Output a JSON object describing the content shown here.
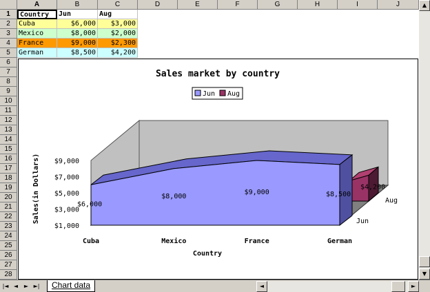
{
  "columns": [
    "A",
    "B",
    "C",
    "D",
    "E",
    "F",
    "G",
    "H",
    "I",
    "J"
  ],
  "rows": [
    "1",
    "2",
    "3",
    "4",
    "5",
    "6",
    "7",
    "8",
    "9",
    "10",
    "11",
    "12",
    "13",
    "14",
    "15",
    "16",
    "17",
    "18",
    "19",
    "20",
    "21",
    "22",
    "23",
    "24",
    "25",
    "26",
    "27",
    "28"
  ],
  "table": {
    "headers": [
      "Country",
      "Jun",
      "Aug"
    ],
    "rows": [
      {
        "country": "Cuba",
        "jun": "$6,000",
        "aug": "$3,000",
        "bg": "#ffff99"
      },
      {
        "country": "Mexico",
        "jun": "$8,000",
        "aug": "$2,000",
        "bg": "#ccffcc"
      },
      {
        "country": "France",
        "jun": "$9,000",
        "aug": "$2,300",
        "bg": "#ff9900"
      },
      {
        "country": "German",
        "jun": "$8,500",
        "aug": "$4,200",
        "bg": "#ccffff"
      }
    ]
  },
  "chart_data": {
    "type": "area",
    "title": "Sales market by country",
    "xlabel": "Country",
    "ylabel": "Sales(in Dollars)",
    "categories": [
      "Cuba",
      "Mexico",
      "France",
      "German"
    ],
    "yticks": [
      "$9,000",
      "$7,000",
      "$5,000",
      "$3,000",
      "$1,000"
    ],
    "ylim": [
      1000,
      9000
    ],
    "legend_position": "top",
    "series": [
      {
        "name": "Jun",
        "values": [
          6000,
          8000,
          9000,
          8500
        ],
        "labels": [
          "$6,000",
          "$8,000",
          "$9,000",
          "$8,500"
        ],
        "color": "#9999ff"
      },
      {
        "name": "Aug",
        "values": [
          3000,
          2000,
          2300,
          4200
        ],
        "labels": [
          "",
          "",
          "",
          "$4,200"
        ],
        "color": "#993366"
      }
    ],
    "depth_labels": [
      "Aug",
      "Jun"
    ],
    "wall_color": "#c0c0c0",
    "grid": false
  },
  "sheet_tab": "Chart data",
  "icons": {
    "scroll_up": "▲",
    "scroll_down": "▼",
    "scroll_left": "◄",
    "scroll_right": "►",
    "tab_first": "|◄",
    "tab_prev": "◄",
    "tab_next": "►",
    "tab_last": "►|"
  }
}
